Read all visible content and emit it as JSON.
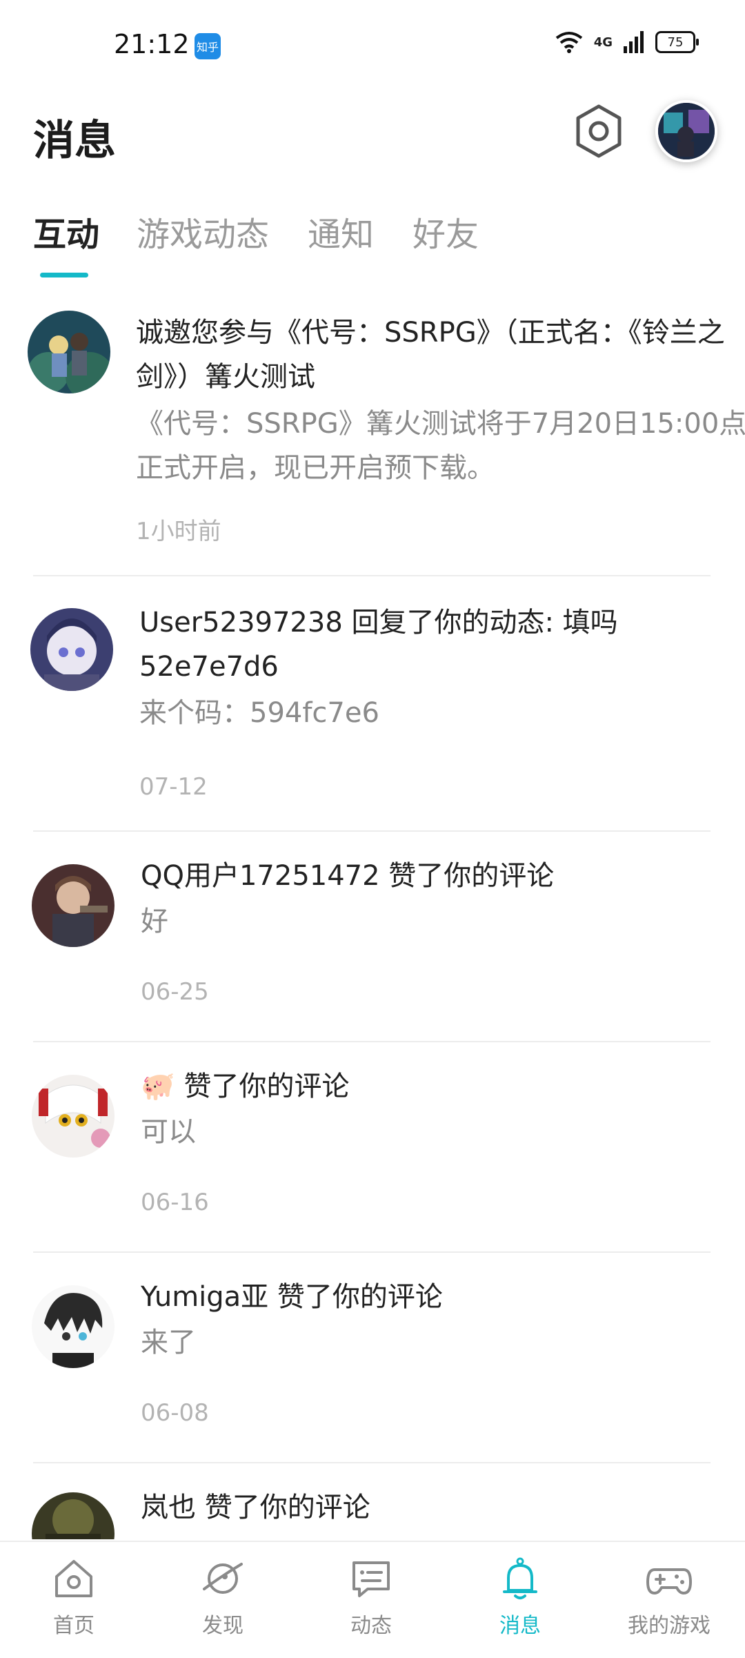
{
  "status_bar": {
    "time": "21:12",
    "app_icon_label": "知乎",
    "network": "4G",
    "battery": "75"
  },
  "header": {
    "title": "消息",
    "settings_icon": "gear-hex-icon"
  },
  "tabs": [
    {
      "label": "互动",
      "active": true
    },
    {
      "label": "游戏动态",
      "active": false
    },
    {
      "label": "通知",
      "active": false
    },
    {
      "label": "好友",
      "active": false
    }
  ],
  "messages": [
    {
      "title": "诚邀您参与《代号：SSRPG》（正式名：《铃兰之剑》）篝火测试",
      "body": "《代号：SSRPG》篝火测试将于7月20日15:00点正式开启，现已开启预下载。",
      "time": "1小时前"
    },
    {
      "title": "User52397238 回复了你的动态: 填吗 52e7e7d6",
      "body": "来个码：594fc7e6",
      "time": "07-12"
    },
    {
      "title": "QQ用户17251472 赞了你的评论",
      "body": "好",
      "time": "06-25"
    },
    {
      "title": "🐖 赞了你的评论",
      "body": "可以",
      "time": "06-16"
    },
    {
      "title": "Yumiga亚 赞了你的评论",
      "body": "来了",
      "time": "06-08"
    },
    {
      "title": "岚也 赞了你的评论",
      "body": "",
      "time": ""
    }
  ],
  "bottom_nav": [
    {
      "label": "首页",
      "icon": "home-icon",
      "active": false
    },
    {
      "label": "发现",
      "icon": "planet-icon",
      "active": false
    },
    {
      "label": "动态",
      "icon": "chat-icon",
      "active": false
    },
    {
      "label": "消息",
      "icon": "bell-icon",
      "active": true
    },
    {
      "label": "我的游戏",
      "icon": "gamepad-icon",
      "active": false
    }
  ],
  "colors": {
    "accent": "#14b9c8",
    "muted": "#8a8a8a"
  }
}
